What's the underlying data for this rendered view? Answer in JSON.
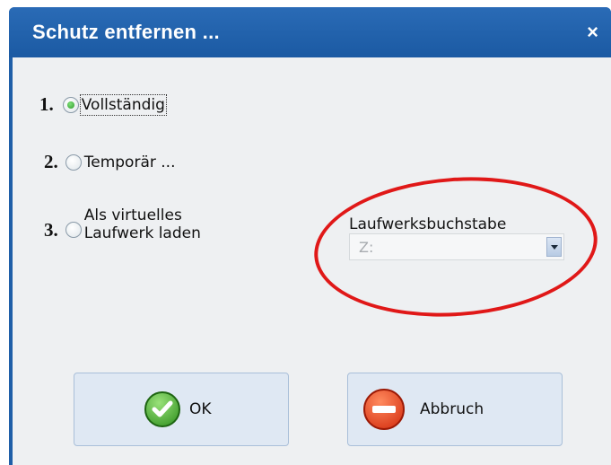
{
  "window": {
    "title": "Schutz entfernen ...",
    "close_glyph": "×"
  },
  "options": [
    {
      "number": "1.",
      "label": "Vollständig",
      "checked": true
    },
    {
      "number": "2.",
      "label": "Temporär ...",
      "checked": false
    },
    {
      "number": "3.",
      "label_line1": "Als virtuelles",
      "label_line2": "Laufwerk laden",
      "checked": false
    }
  ],
  "drive": {
    "label": "Laufwerksbuchstabe",
    "value": "Z:"
  },
  "buttons": {
    "ok_label": "OK",
    "cancel_label": "Abbruch"
  },
  "icons": {
    "ok": "check-circle-icon",
    "cancel": "stop-icon"
  },
  "colors": {
    "title_bar": "#1f5fa8",
    "highlight_ellipse": "#e01818",
    "button_bg": "#dfe8f3"
  }
}
